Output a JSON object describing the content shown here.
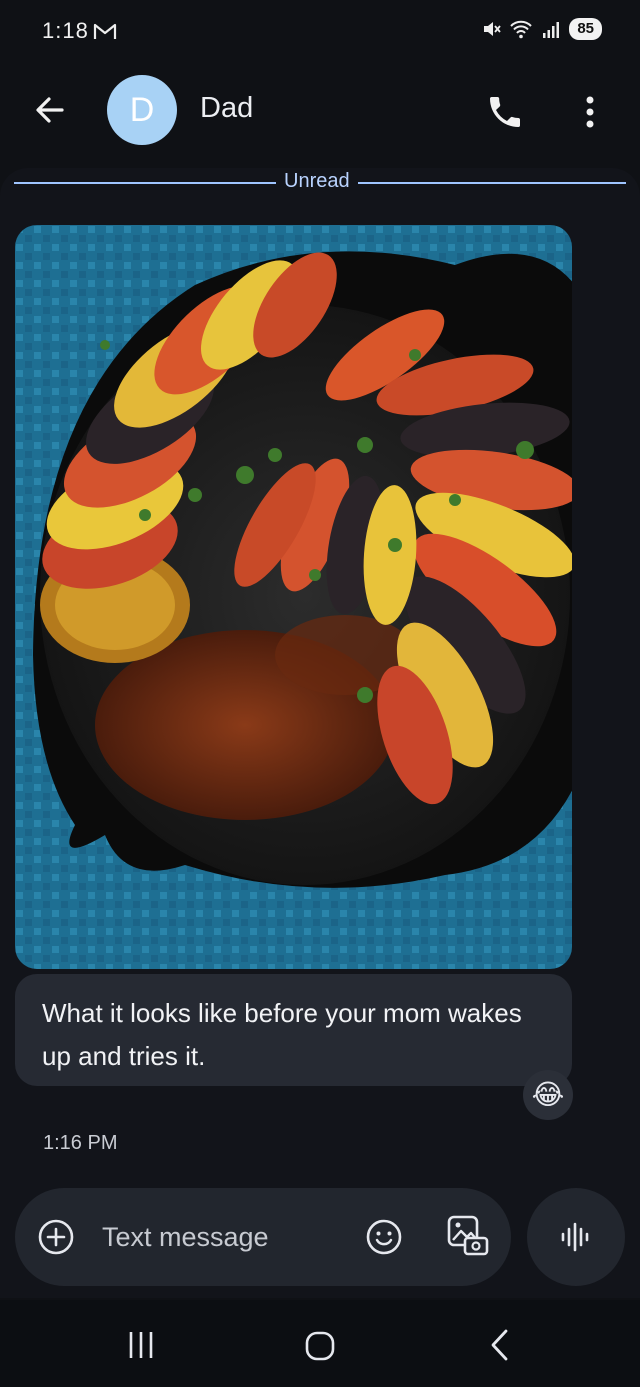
{
  "status_bar": {
    "time": "1:18",
    "notification_icon": "gmail-icon",
    "battery": "85"
  },
  "header": {
    "avatar_letter": "D",
    "avatar_color": "#a8d2f5",
    "contact_name": "Dad"
  },
  "conversation": {
    "unread_label": "Unread",
    "photo_description_icon": "ratatouille-photo",
    "message_text": "What it looks like before your mom wakes up and tries it.",
    "reaction": "😂",
    "timestamp": "1:16 PM"
  },
  "compose": {
    "placeholder": "Text message"
  },
  "colors": {
    "accent": "#9fc5ff",
    "bubble": "#262a33",
    "background": "#0f1115"
  }
}
